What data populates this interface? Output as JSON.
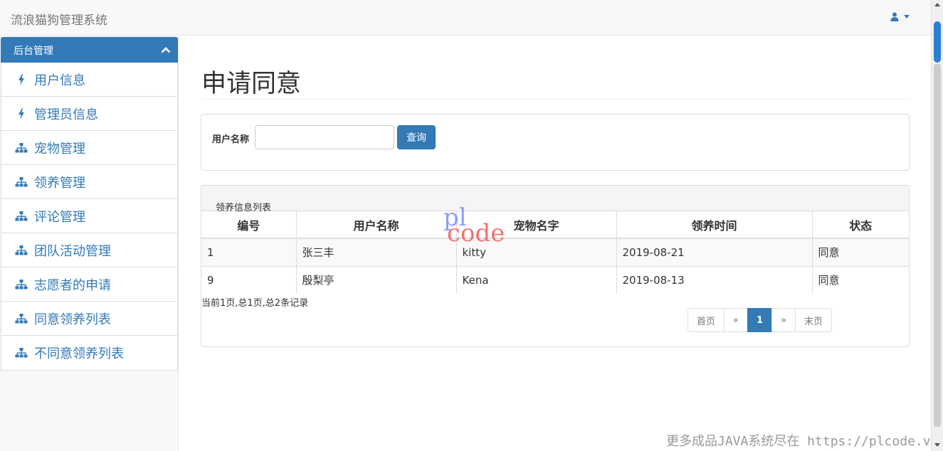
{
  "navbar": {
    "brand": "流浪猫狗管理系统",
    "user_icon": "user-icon"
  },
  "sidebar": {
    "header": "后台管理",
    "items": [
      {
        "label": "用户信息",
        "icon": "bolt-icon"
      },
      {
        "label": "管理员信息",
        "icon": "bolt-icon"
      },
      {
        "label": "宠物管理",
        "icon": "sitemap-icon"
      },
      {
        "label": "领养管理",
        "icon": "sitemap-icon"
      },
      {
        "label": "评论管理",
        "icon": "sitemap-icon"
      },
      {
        "label": "团队活动管理",
        "icon": "sitemap-icon"
      },
      {
        "label": "志愿者的申请",
        "icon": "sitemap-icon"
      },
      {
        "label": "同意领养列表",
        "icon": "sitemap-icon"
      },
      {
        "label": "不同意领养列表",
        "icon": "sitemap-icon"
      }
    ]
  },
  "main": {
    "title": "申请同意",
    "search": {
      "label": "用户名称",
      "value": "",
      "button": "查询"
    },
    "list": {
      "title": "领养信息列表",
      "columns": [
        "编号",
        "用户名称",
        "宠物名字",
        "领养时间",
        "状态"
      ],
      "rows": [
        [
          "1",
          "张三丰",
          "kitty",
          "2019-08-21",
          "同意"
        ],
        [
          "9",
          "殷梨亭",
          "Kena",
          "2019-08-13",
          "同意"
        ]
      ],
      "record_info": "当前1页,总1页,总2条记录",
      "pager": {
        "first": "首页",
        "prev": "«",
        "current": "1",
        "next": "»",
        "last": "末页"
      }
    }
  },
  "watermark": {
    "pl": "pl",
    "code": "code",
    "footer": "更多成品JAVA系统尽在 https://plcode.vip"
  },
  "colors": {
    "primary": "#337ab7",
    "navbar_bg": "#f8f8f8"
  }
}
